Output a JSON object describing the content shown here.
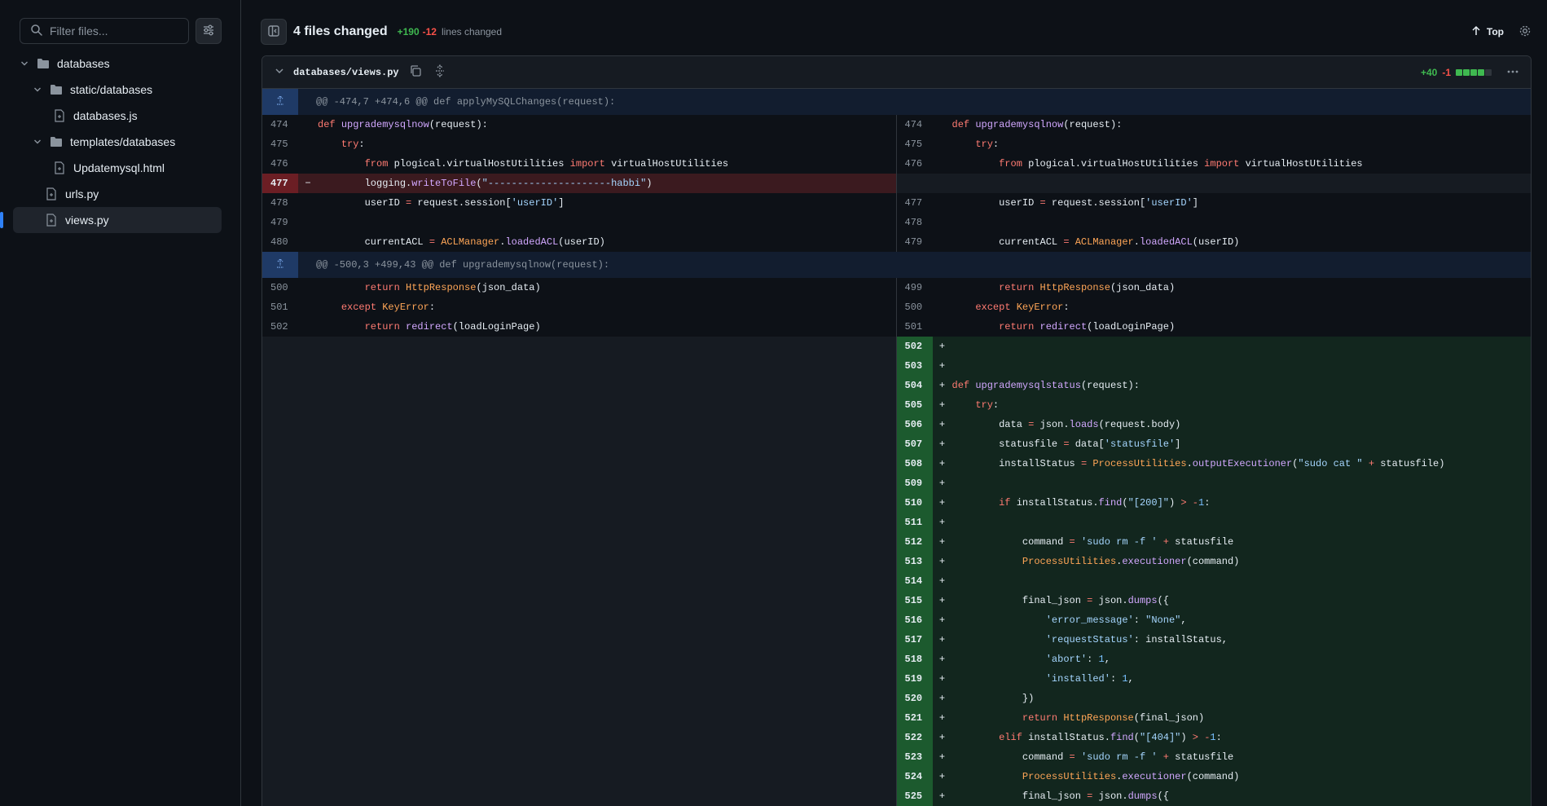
{
  "sidebar": {
    "filter_placeholder": "Filter files...",
    "tree": [
      {
        "label": "databases",
        "type": "folder",
        "level": 0,
        "expanded": true
      },
      {
        "label": "static/databases",
        "type": "folder",
        "level": 1,
        "expanded": true
      },
      {
        "label": "databases.js",
        "type": "file",
        "level": 2
      },
      {
        "label": "templates/databases",
        "type": "folder",
        "level": 1,
        "expanded": true
      },
      {
        "label": "Updatemysql.html",
        "type": "file",
        "level": 2
      },
      {
        "label": "urls.py",
        "type": "file",
        "level": 1
      },
      {
        "label": "views.py",
        "type": "file",
        "level": 1,
        "active": true
      }
    ]
  },
  "header": {
    "title": "4 files changed",
    "additions": "+190",
    "deletions": "-12",
    "lines_label": "lines changed",
    "top_label": "Top"
  },
  "file": {
    "name": "databases/views.py",
    "additions": "+40",
    "deletions": "-1",
    "blocks": [
      "add",
      "add",
      "add",
      "add",
      "neutral"
    ]
  },
  "colors": {
    "added": "#3fb950",
    "deleted": "#f85149",
    "accent": "#2f81f7"
  },
  "hunks": [
    {
      "header": "@@ -474,7 +474,6 @@ def applyMySQLChanges(request):",
      "rows": [
        {
          "l": "474",
          "r": "474",
          "type": "ctx",
          "html": "<span class=\"kw\">def</span> <span class=\"fn\">upgrademysqlnow</span>(request):"
        },
        {
          "l": "475",
          "r": "475",
          "type": "ctx",
          "html": "    <span class=\"kw\">try</span>:"
        },
        {
          "l": "476",
          "r": "476",
          "type": "ctx",
          "html": "        <span class=\"kw\">from</span> plogical.virtualHostUtilities <span class=\"kw\">import</span> virtualHostUtilities"
        },
        {
          "l": "477",
          "r": "",
          "type": "del",
          "html": "        logging.<span class=\"fn\">writeToFile</span>(<span class=\"str\">\"---------------------habbi\"</span>)"
        },
        {
          "l": "478",
          "r": "477",
          "type": "ctx",
          "html": "        userID <span class=\"kw\">=</span> request.session[<span class=\"str\">'userID'</span>]"
        },
        {
          "l": "479",
          "r": "478",
          "type": "ctx",
          "html": ""
        },
        {
          "l": "480",
          "r": "479",
          "type": "ctx",
          "html": "        currentACL <span class=\"kw\">=</span> <span class=\"cls\">ACLManager</span>.<span class=\"fn\">loadedACL</span>(userID)"
        }
      ]
    },
    {
      "header": "@@ -500,3 +499,43 @@ def upgrademysqlnow(request):",
      "rows": [
        {
          "l": "500",
          "r": "499",
          "type": "ctx",
          "html": "        <span class=\"kw\">return</span> <span class=\"cls\">HttpResponse</span>(json_data)"
        },
        {
          "l": "501",
          "r": "500",
          "type": "ctx",
          "html": "    <span class=\"kw\">except</span> <span class=\"cls\">KeyError</span>:"
        },
        {
          "l": "502",
          "r": "501",
          "type": "ctx",
          "html": "        <span class=\"kw\">return</span> <span class=\"fn\">redirect</span>(loadLoginPage)"
        },
        {
          "l": "",
          "r": "502",
          "type": "add",
          "html": ""
        },
        {
          "l": "",
          "r": "503",
          "type": "add",
          "html": ""
        },
        {
          "l": "",
          "r": "504",
          "type": "add",
          "html": "<span class=\"kw\">def</span> <span class=\"fn\">upgrademysqlstatus</span>(request):"
        },
        {
          "l": "",
          "r": "505",
          "type": "add",
          "html": "    <span class=\"kw\">try</span>:"
        },
        {
          "l": "",
          "r": "506",
          "type": "add",
          "html": "        data <span class=\"kw\">=</span> json.<span class=\"fn\">loads</span>(request.body)"
        },
        {
          "l": "",
          "r": "507",
          "type": "add",
          "html": "        statusfile <span class=\"kw\">=</span> data[<span class=\"str\">'statusfile'</span>]"
        },
        {
          "l": "",
          "r": "508",
          "type": "add",
          "html": "        installStatus <span class=\"kw\">=</span> <span class=\"cls\">ProcessUtilities</span>.<span class=\"fn\">outputExecutioner</span>(<span class=\"str\">\"sudo cat \"</span> <span class=\"kw\">+</span> statusfile)"
        },
        {
          "l": "",
          "r": "509",
          "type": "add",
          "html": ""
        },
        {
          "l": "",
          "r": "510",
          "type": "add",
          "html": "        <span class=\"kw\">if</span> installStatus.<span class=\"fn\">find</span>(<span class=\"str\">\"[200]\"</span>) <span class=\"kw\">&gt;</span> <span class=\"kw\">-</span><span class=\"num\">1</span>:"
        },
        {
          "l": "",
          "r": "511",
          "type": "add",
          "html": ""
        },
        {
          "l": "",
          "r": "512",
          "type": "add",
          "html": "            command <span class=\"kw\">=</span> <span class=\"str\">'sudo rm -f '</span> <span class=\"kw\">+</span> statusfile"
        },
        {
          "l": "",
          "r": "513",
          "type": "add",
          "html": "            <span class=\"cls\">ProcessUtilities</span>.<span class=\"fn\">executioner</span>(command)"
        },
        {
          "l": "",
          "r": "514",
          "type": "add",
          "html": ""
        },
        {
          "l": "",
          "r": "515",
          "type": "add",
          "html": "            final_json <span class=\"kw\">=</span> json.<span class=\"fn\">dumps</span>({"
        },
        {
          "l": "",
          "r": "516",
          "type": "add",
          "html": "                <span class=\"str\">'error_message'</span>: <span class=\"str\">\"None\"</span>,"
        },
        {
          "l": "",
          "r": "517",
          "type": "add",
          "html": "                <span class=\"str\">'requestStatus'</span>: installStatus,"
        },
        {
          "l": "",
          "r": "518",
          "type": "add",
          "html": "                <span class=\"str\">'abort'</span>: <span class=\"num\">1</span>,"
        },
        {
          "l": "",
          "r": "519",
          "type": "add",
          "html": "                <span class=\"str\">'installed'</span>: <span class=\"num\">1</span>,"
        },
        {
          "l": "",
          "r": "520",
          "type": "add",
          "html": "            })"
        },
        {
          "l": "",
          "r": "521",
          "type": "add",
          "html": "            <span class=\"kw\">return</span> <span class=\"cls\">HttpResponse</span>(final_json)"
        },
        {
          "l": "",
          "r": "522",
          "type": "add",
          "html": "        <span class=\"kw\">elif</span> installStatus.<span class=\"fn\">find</span>(<span class=\"str\">\"[404]\"</span>) <span class=\"kw\">&gt;</span> <span class=\"kw\">-</span><span class=\"num\">1</span>:"
        },
        {
          "l": "",
          "r": "523",
          "type": "add",
          "html": "            command <span class=\"kw\">=</span> <span class=\"str\">'sudo rm -f '</span> <span class=\"kw\">+</span> statusfile"
        },
        {
          "l": "",
          "r": "524",
          "type": "add",
          "html": "            <span class=\"cls\">ProcessUtilities</span>.<span class=\"fn\">executioner</span>(command)"
        },
        {
          "l": "",
          "r": "525",
          "type": "add",
          "html": "            final_json <span class=\"kw\">=</span> json.<span class=\"fn\">dumps</span>({"
        }
      ]
    }
  ]
}
